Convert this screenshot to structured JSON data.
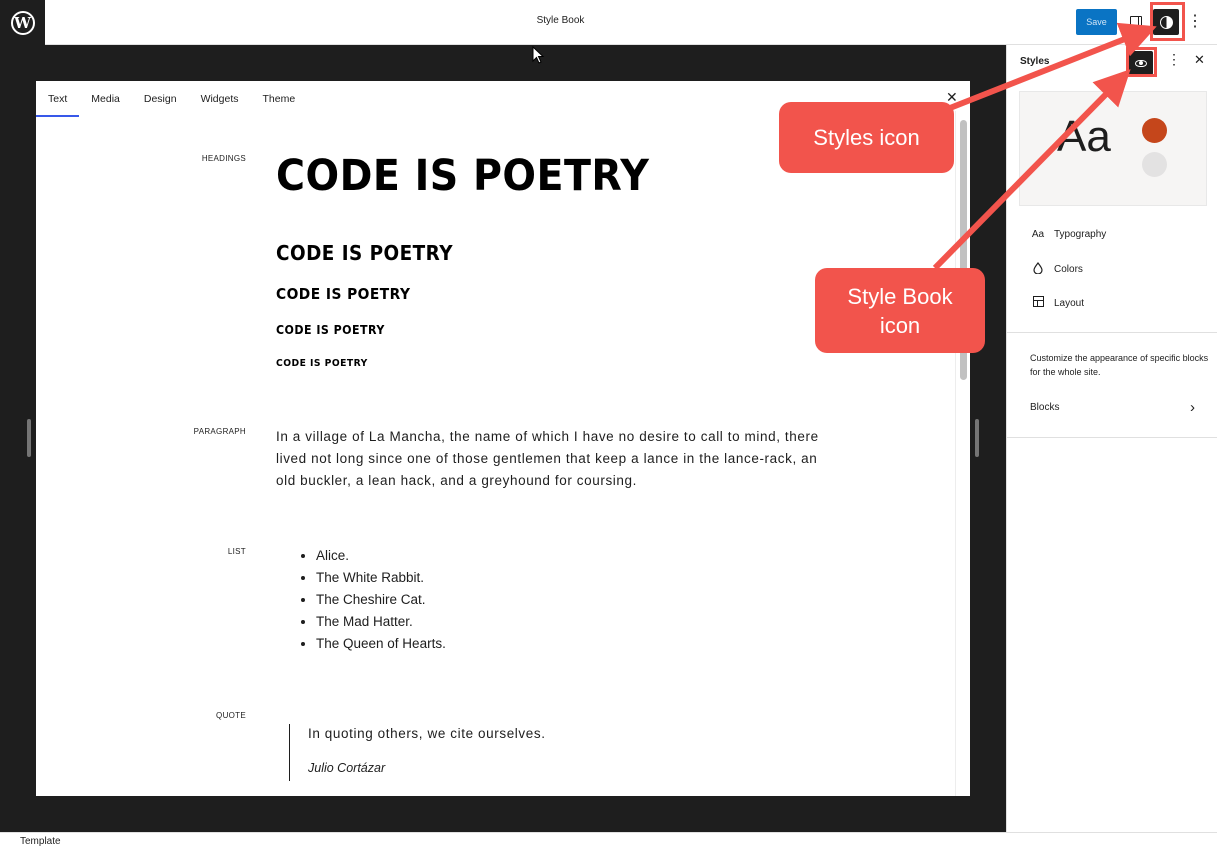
{
  "topbar": {
    "doc_title": "Style Book",
    "save_label": "Save",
    "more_glyph": "⋮"
  },
  "stylebook": {
    "tabs": [
      {
        "label": "Text",
        "active": true
      },
      {
        "label": "Media"
      },
      {
        "label": "Design"
      },
      {
        "label": "Widgets"
      },
      {
        "label": "Theme"
      }
    ],
    "close_glyph": "✕",
    "sections": {
      "headings": {
        "label": "HEADINGS",
        "h1": "CODE IS POETRY",
        "h2": "CODE IS POETRY",
        "h3": "CODE IS POETRY",
        "h4": "CODE IS POETRY",
        "h5": "CODE IS POETRY"
      },
      "paragraph": {
        "label": "PARAGRAPH",
        "text": "In a village of La Mancha, the name of which I have no desire to call to mind, there lived not long since one of those gentlemen that keep a lance in the lance-rack, an old buckler, a lean hack, and a greyhound for coursing."
      },
      "list": {
        "label": "LIST",
        "items": [
          "Alice.",
          "The White Rabbit.",
          "The Cheshire Cat.",
          "The Mad Hatter.",
          "The Queen of Hearts."
        ]
      },
      "quote": {
        "label": "QUOTE",
        "text": "In quoting others, we cite ourselves.",
        "cite": "Julio Cortázar"
      }
    }
  },
  "sidebar": {
    "title": "Styles",
    "more_glyph": "⋮",
    "close_glyph": "✕",
    "preview_text": "Aa",
    "preview_colors": [
      "#c5461b",
      "#e3e2e2"
    ],
    "items": [
      {
        "label": "Typography",
        "icon": "typography-icon",
        "glyph": "Aa"
      },
      {
        "label": "Colors",
        "icon": "droplet-icon",
        "glyph": "💧"
      },
      {
        "label": "Layout",
        "icon": "layout-icon",
        "glyph": ""
      }
    ],
    "description": "Customize the appearance of specific blocks for the whole site.",
    "blocks_label": "Blocks",
    "blocks_chevron": "›"
  },
  "footer": {
    "label": "Template"
  },
  "annotations": {
    "styles_callout": "Styles icon",
    "stylebook_callout_line1": "Style Book",
    "stylebook_callout_line2": "icon",
    "color": "#f2544c"
  },
  "colors": {
    "accent": "#0a74c4",
    "tab_indicator": "#3858e9",
    "canvas_bg": "#1e1e1e"
  }
}
